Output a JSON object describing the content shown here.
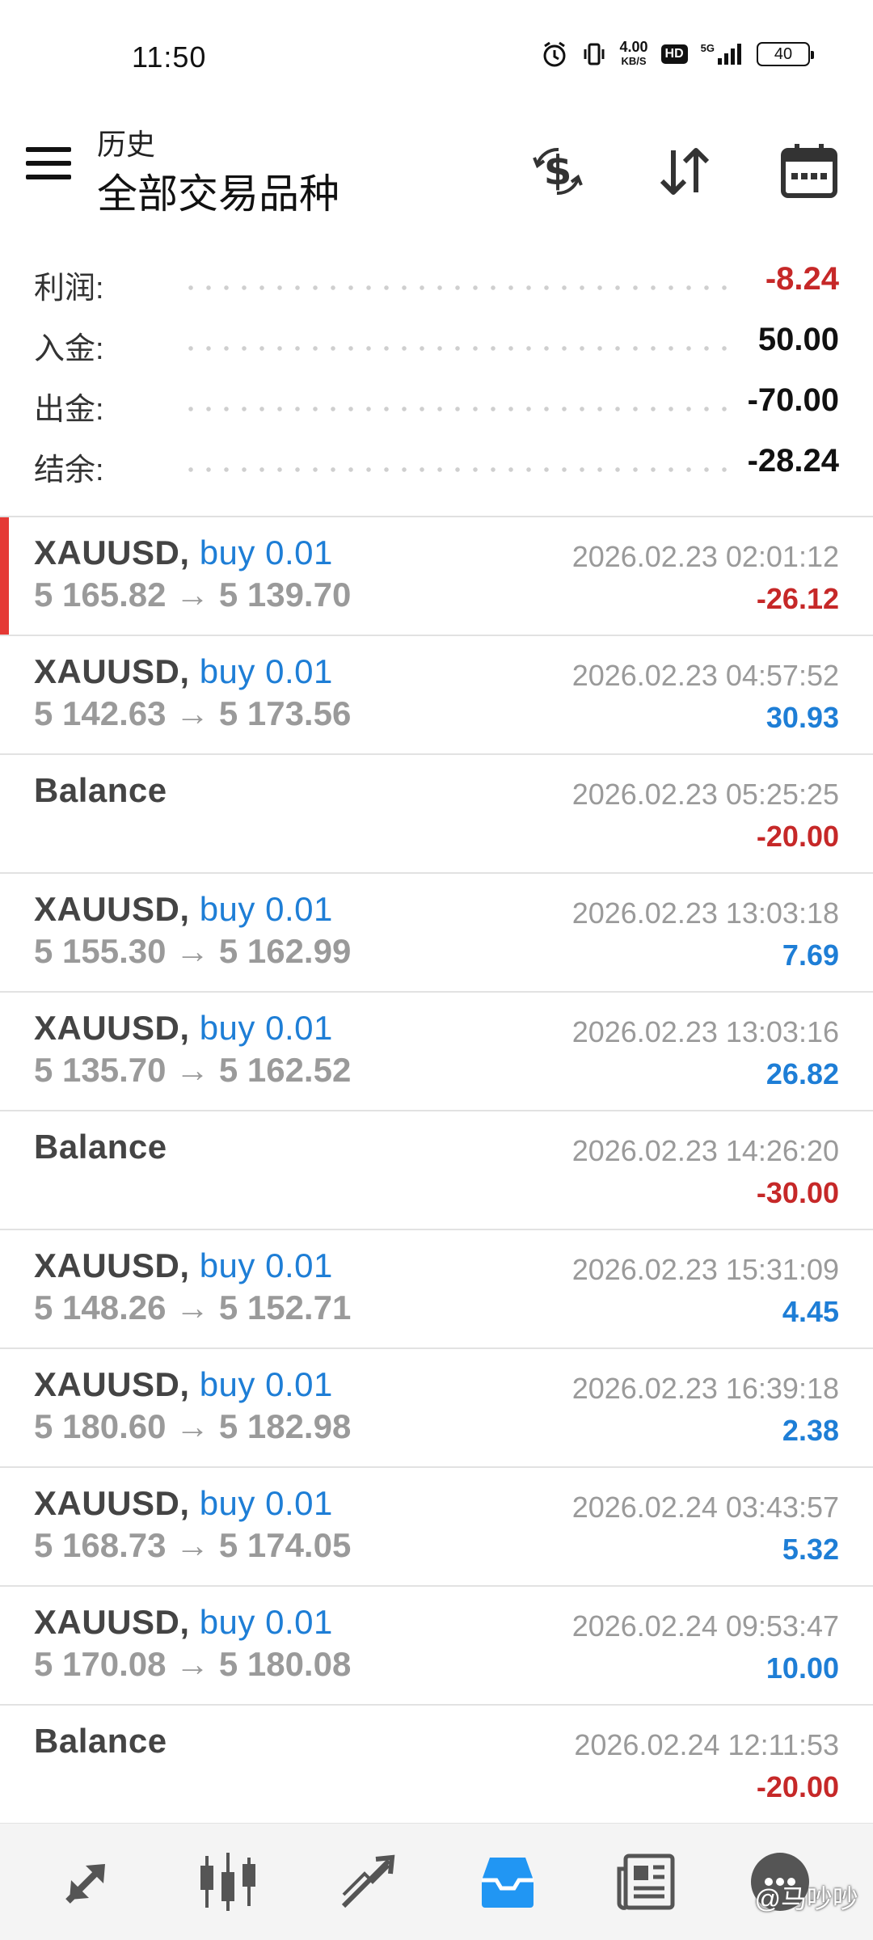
{
  "status_bar": {
    "time": "11:50",
    "speed_value": "4.00",
    "speed_unit": "KB/S",
    "hd_label": "HD",
    "network_label": "5G",
    "battery": "40"
  },
  "header": {
    "subtitle": "历史",
    "title": "全部交易品种"
  },
  "summary": [
    {
      "label": "利润:",
      "value": "-8.24",
      "negative": true
    },
    {
      "label": "入金:",
      "value": "50.00",
      "negative": false
    },
    {
      "label": "出金:",
      "value": "-70.00",
      "negative": false
    },
    {
      "label": "结余:",
      "value": "-28.24",
      "negative": false
    }
  ],
  "deals": [
    {
      "symbol": "XAUUSD,",
      "type": "buy 0.01",
      "prices": "5 165.82 → 5 139.70",
      "time": "2026.02.23 02:01:12",
      "profit": "-26.12"
    },
    {
      "symbol": "XAUUSD,",
      "type": "buy 0.01",
      "prices": "5 142.63 → 5 173.56",
      "time": "2026.02.23 04:57:52",
      "profit": "30.93"
    },
    {
      "symbol": "Balance",
      "type": "",
      "prices": "",
      "time": "2026.02.23 05:25:25",
      "profit": "-20.00"
    },
    {
      "symbol": "XAUUSD,",
      "type": "buy 0.01",
      "prices": "5 155.30 → 5 162.99",
      "time": "2026.02.23 13:03:18",
      "profit": "7.69"
    },
    {
      "symbol": "XAUUSD,",
      "type": "buy 0.01",
      "prices": "5 135.70 → 5 162.52",
      "time": "2026.02.23 13:03:16",
      "profit": "26.82"
    },
    {
      "symbol": "Balance",
      "type": "",
      "prices": "",
      "time": "2026.02.23 14:26:20",
      "profit": "-30.00"
    },
    {
      "symbol": "XAUUSD,",
      "type": "buy 0.01",
      "prices": "5 148.26 → 5 152.71",
      "time": "2026.02.23 15:31:09",
      "profit": "4.45"
    },
    {
      "symbol": "XAUUSD,",
      "type": "buy 0.01",
      "prices": "5 180.60 → 5 182.98",
      "time": "2026.02.23 16:39:18",
      "profit": "2.38"
    },
    {
      "symbol": "XAUUSD,",
      "type": "buy 0.01",
      "prices": "5 168.73 → 5 174.05",
      "time": "2026.02.24 03:43:57",
      "profit": "5.32"
    },
    {
      "symbol": "XAUUSD,",
      "type": "buy 0.01",
      "prices": "5 170.08 → 5 180.08",
      "time": "2026.02.24 09:53:47",
      "profit": "10.00"
    },
    {
      "symbol": "Balance",
      "type": "",
      "prices": "",
      "time": "2026.02.24 12:11:53",
      "profit": "-20.00"
    }
  ],
  "colors": {
    "positive": "#1e7ed6",
    "negative": "#c62828",
    "active_tab": "#2196f3",
    "selected_marker": "#e53935"
  },
  "nav": {
    "items": [
      "quotes-icon",
      "chart-icon",
      "trade-icon",
      "history-icon",
      "news-icon",
      "chat-icon"
    ],
    "active": "history-icon"
  },
  "watermark": "@马吵吵"
}
